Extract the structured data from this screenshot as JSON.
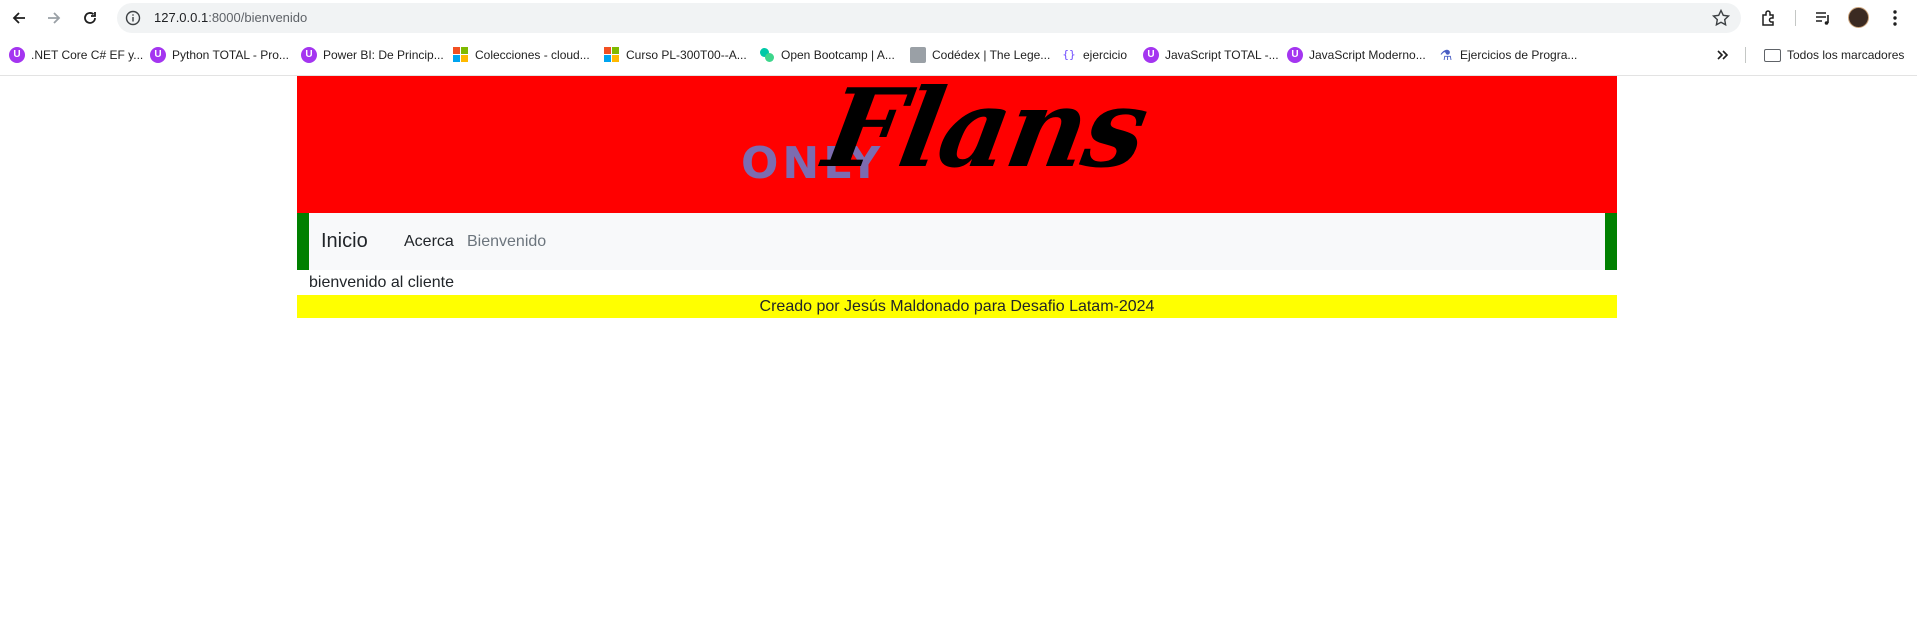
{
  "browser": {
    "url_host": "127.0.0.1",
    "url_rest": ":8000/bienvenido",
    "bookmarks": [
      {
        "label": ".NET Core C# EF y...",
        "icon": "udemy-icon"
      },
      {
        "label": "Python TOTAL - Pro...",
        "icon": "udemy-icon"
      },
      {
        "label": "Power BI: De Princip...",
        "icon": "udemy-icon"
      },
      {
        "label": "Colecciones - cloud...",
        "icon": "microsoft-icon"
      },
      {
        "label": "Curso PL-300T00--A...",
        "icon": "microsoft-icon"
      },
      {
        "label": "Open Bootcamp | A...",
        "icon": "openbootcamp-icon"
      },
      {
        "label": "Codédex | The Lege...",
        "icon": "codedex-icon"
      },
      {
        "label": "ejercicio",
        "icon": "code-braces-icon"
      },
      {
        "label": "JavaScript TOTAL -...",
        "icon": "udemy-icon"
      },
      {
        "label": "JavaScript Moderno...",
        "icon": "udemy-icon"
      },
      {
        "label": "Ejercicios de Progra...",
        "icon": "flask-icon"
      }
    ],
    "all_bookmarks": "Todos los marcadores"
  },
  "site": {
    "logo_only": "ONLY",
    "logo_flans": "Flans",
    "nav": {
      "brand": "Inicio",
      "links": [
        "Acerca",
        "Bienvenido"
      ]
    },
    "content": "bienvenido al cliente",
    "footer": "Creado por Jesús Maldonado para Desafio Latam-2024"
  },
  "colors": {
    "banner": "#ff0000",
    "nav_border": "#008000",
    "footer_bg": "#ffff00",
    "logo_only": "#7c6cb0"
  }
}
